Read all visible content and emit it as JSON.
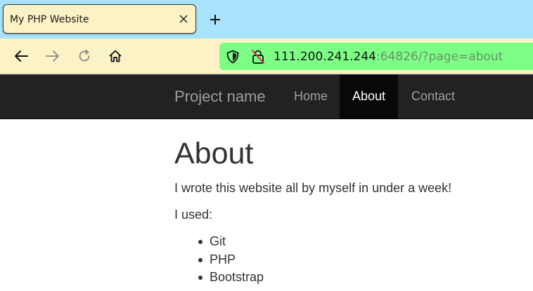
{
  "browser": {
    "tab": {
      "title": "My PHP Website",
      "close_icon": "close-icon"
    },
    "new_tab_icon": "plus-icon",
    "toolbar": {
      "back_icon": "arrow-left-icon",
      "forward_icon": "arrow-right-icon",
      "reload_icon": "reload-icon",
      "home_icon": "home-icon"
    },
    "address_bar": {
      "host": "111.200.241.244",
      "rest": ":64826/?page=about",
      "shield_icon": "shield-icon",
      "lock_icon": "insecure-lock-icon"
    },
    "colors": {
      "tabstrip": "#a9e3fb",
      "toolbar": "#fbf3c5",
      "urlbar": "#7dff86"
    }
  },
  "site": {
    "navbar": {
      "brand": "Project name",
      "links": [
        {
          "label": "Home",
          "active": false
        },
        {
          "label": "About",
          "active": true
        },
        {
          "label": "Contact",
          "active": false
        }
      ]
    },
    "page": {
      "title": "About",
      "paragraphs": [
        "I wrote this website all by myself in under a week!",
        "I used:"
      ],
      "list": [
        "Git",
        "PHP",
        "Bootstrap"
      ]
    }
  }
}
